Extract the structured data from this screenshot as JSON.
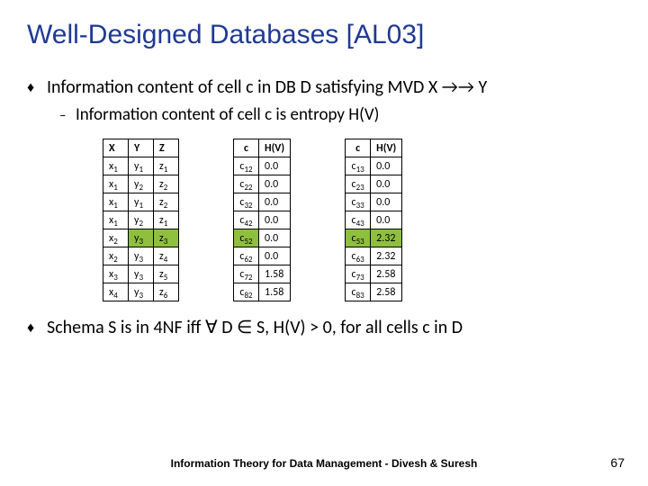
{
  "title": "Well-Designed Databases [AL03]",
  "bullet1": "Information content of cell c in DB D satisfying MVD X →→  Y",
  "sub1": "Information content of cell c is entropy H(V)",
  "bullet2_prefix": "Schema S is in 4NF iff ",
  "bullet2_suffix": " D ∈ S, H(V) > 0, for all cells c in D",
  "forall": "∀",
  "t1": {
    "head": [
      "X",
      "Y",
      "Z"
    ],
    "rows": [
      [
        "x1",
        "y1",
        "z1"
      ],
      [
        "x1",
        "y2",
        "z2"
      ],
      [
        "x1",
        "y1",
        "z2"
      ],
      [
        "x1",
        "y2",
        "z1"
      ],
      [
        "x2",
        "y3",
        "z3"
      ],
      [
        "x2",
        "y3",
        "z4"
      ],
      [
        "x3",
        "y3",
        "z5"
      ],
      [
        "x4",
        "y3",
        "z6"
      ]
    ],
    "hl_row": 4
  },
  "t2a": {
    "head": [
      "c",
      "H(V)"
    ],
    "rows": [
      [
        "c12",
        "0.0"
      ],
      [
        "c22",
        "0.0"
      ],
      [
        "c32",
        "0.0"
      ],
      [
        "c42",
        "0.0"
      ],
      [
        "c52",
        "0.0"
      ],
      [
        "c62",
        "0.0"
      ],
      [
        "c72",
        "1.58"
      ],
      [
        "c82",
        "1.58"
      ]
    ],
    "hl_row": 4
  },
  "t2b": {
    "head": [
      "c",
      "H(V)"
    ],
    "rows": [
      [
        "c13",
        "0.0"
      ],
      [
        "c23",
        "0.0"
      ],
      [
        "c33",
        "0.0"
      ],
      [
        "c43",
        "0.0"
      ],
      [
        "c53",
        "2.32"
      ],
      [
        "c63",
        "2.32"
      ],
      [
        "c73",
        "2.58"
      ],
      [
        "c83",
        "2.58"
      ]
    ],
    "hl_row": 4
  },
  "footer": "Information Theory for Data Management - Divesh & Suresh",
  "page": "67"
}
